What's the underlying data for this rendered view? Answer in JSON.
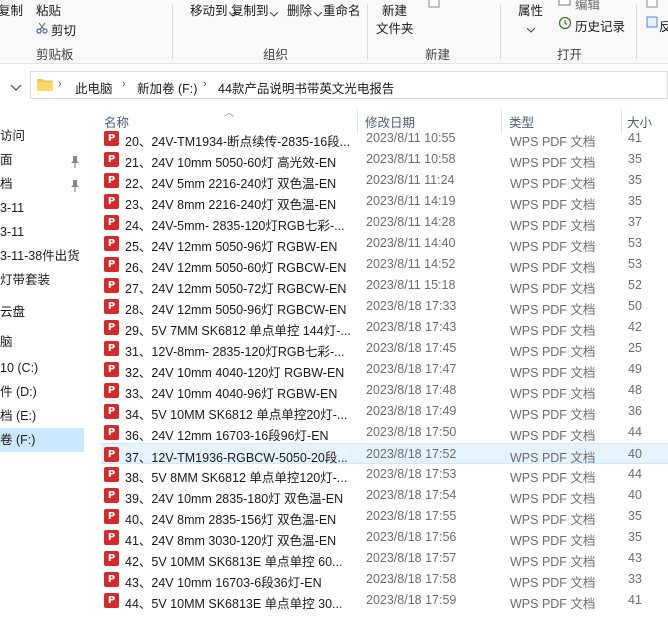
{
  "ribbon": {
    "copy_label": "复制",
    "paste_label": "粘贴",
    "cut_label": "剪切",
    "clipboard_group": "剪贴板",
    "move_to_label": "移动到",
    "copy_to_label": "复制到",
    "delete_label": "删除",
    "rename_label": "重命名",
    "organize_group": "组织",
    "new_label": "新建",
    "new_folder_label": "文件夹",
    "new_group": "新建",
    "properties_label": "属性",
    "edit_label": "编辑",
    "history_label": "历史记录",
    "open_group": "打开",
    "select_label": "反"
  },
  "address": {
    "crumbs": [
      "此电脑",
      "新加卷 (F:)",
      "44款产品说明书带英文光电报告"
    ]
  },
  "nav": {
    "items": [
      {
        "label": "访问",
        "pinned": false,
        "selected": false
      },
      {
        "label": "面",
        "pinned": true,
        "selected": false
      },
      {
        "label": "档",
        "pinned": true,
        "selected": false
      },
      {
        "label": "3-11",
        "pinned": false,
        "selected": false
      },
      {
        "label": "3-11",
        "pinned": false,
        "selected": false
      },
      {
        "label": "3-11-38件出货",
        "pinned": false,
        "selected": false
      },
      {
        "label": "灯带套装",
        "pinned": false,
        "selected": false
      },
      {
        "label": "云盘",
        "pinned": false,
        "selected": false
      },
      {
        "label": "脑",
        "pinned": false,
        "selected": false
      },
      {
        "label": "10 (C:)",
        "pinned": false,
        "selected": false
      },
      {
        "label": "件 (D:)",
        "pinned": false,
        "selected": false
      },
      {
        "label": "档 (E:)",
        "pinned": false,
        "selected": false
      },
      {
        "label": "卷 (F:)",
        "pinned": false,
        "selected": true
      }
    ]
  },
  "columns": {
    "name": "名称",
    "date": "修改日期",
    "type": "类型",
    "size": "大小"
  },
  "files": [
    {
      "name": "20、24V-TM1934-断点续传-2835-16段...",
      "date": "2023/8/11 10:55",
      "type": "WPS PDF 文档",
      "size": "41"
    },
    {
      "name": "21、24V 10mm 5050-60灯 高光效-EN",
      "date": "2023/8/11 10:58",
      "type": "WPS PDF 文档",
      "size": "35"
    },
    {
      "name": "22、24V 5mm 2216-240灯 双色温-EN",
      "date": "2023/8/11 11:24",
      "type": "WPS PDF 文档",
      "size": "35"
    },
    {
      "name": "23、24V 8mm 2216-240灯 双色温-EN",
      "date": "2023/8/11 14:19",
      "type": "WPS PDF 文档",
      "size": "35"
    },
    {
      "name": "24、24V-5mm- 2835-120灯RGB七彩-...",
      "date": "2023/8/11 14:28",
      "type": "WPS PDF 文档",
      "size": "37"
    },
    {
      "name": "25、24V 12mm 5050-96灯 RGBW-EN",
      "date": "2023/8/11 14:40",
      "type": "WPS PDF 文档",
      "size": "53"
    },
    {
      "name": "26、24V 12mm 5050-60灯 RGBCW-EN",
      "date": "2023/8/11 14:52",
      "type": "WPS PDF 文档",
      "size": "53"
    },
    {
      "name": "27、24V 12mm 5050-72灯 RGBCW-EN",
      "date": "2023/8/11 15:18",
      "type": "WPS PDF 文档",
      "size": "52"
    },
    {
      "name": "28、24V 12mm 5050-96灯 RGBCW-EN",
      "date": "2023/8/18 17:33",
      "type": "WPS PDF 文档",
      "size": "50"
    },
    {
      "name": "29、5V 7MM SK6812 单点单控 144灯-...",
      "date": "2023/8/18 17:43",
      "type": "WPS PDF 文档",
      "size": "42"
    },
    {
      "name": "31、12V-8mm- 2835-120灯RGB七彩-...",
      "date": "2023/8/18 17:45",
      "type": "WPS PDF 文档",
      "size": "25"
    },
    {
      "name": "32、24V 10mm 4040-120灯 RGBW-EN",
      "date": "2023/8/18 17:47",
      "type": "WPS PDF 文档",
      "size": "49"
    },
    {
      "name": "33、24V 10mm 4040-96灯 RGBW-EN",
      "date": "2023/8/18 17:48",
      "type": "WPS PDF 文档",
      "size": "48"
    },
    {
      "name": "34、5V 10MM SK6812 单点单控20灯-...",
      "date": "2023/8/18 17:49",
      "type": "WPS PDF 文档",
      "size": "36"
    },
    {
      "name": "36、24V 12mm 16703-16段96灯-EN",
      "date": "2023/8/18 17:50",
      "type": "WPS PDF 文档",
      "size": "44"
    },
    {
      "name": "37、12V-TM1936-RGBCW-5050-20段...",
      "date": "2023/8/18 17:52",
      "type": "WPS PDF 文档",
      "size": "40",
      "highlighted": true
    },
    {
      "name": "38、5V 8MM SK6812 单点单控120灯-...",
      "date": "2023/8/18 17:53",
      "type": "WPS PDF 文档",
      "size": "44"
    },
    {
      "name": "39、24V 10mm 2835-180灯 双色温-EN",
      "date": "2023/8/18 17:54",
      "type": "WPS PDF 文档",
      "size": "40"
    },
    {
      "name": "40、24V 8mm 2835-156灯 双色温-EN",
      "date": "2023/8/18 17:55",
      "type": "WPS PDF 文档",
      "size": "35"
    },
    {
      "name": "41、24V 8mm 3030-120灯 双色温-EN",
      "date": "2023/8/18 17:56",
      "type": "WPS PDF 文档",
      "size": "35"
    },
    {
      "name": "42、5V 10MM SK6813E 单点单控 60...",
      "date": "2023/8/18 17:57",
      "type": "WPS PDF 文档",
      "size": "43"
    },
    {
      "name": "43、24V 10mm 16703-6段36灯-EN",
      "date": "2023/8/18 17:58",
      "type": "WPS PDF 文档",
      "size": "33"
    },
    {
      "name": "44、5V 10MM SK6813E 单点单控 30...",
      "date": "2023/8/18 17:59",
      "type": "WPS PDF 文档",
      "size": "41"
    }
  ]
}
